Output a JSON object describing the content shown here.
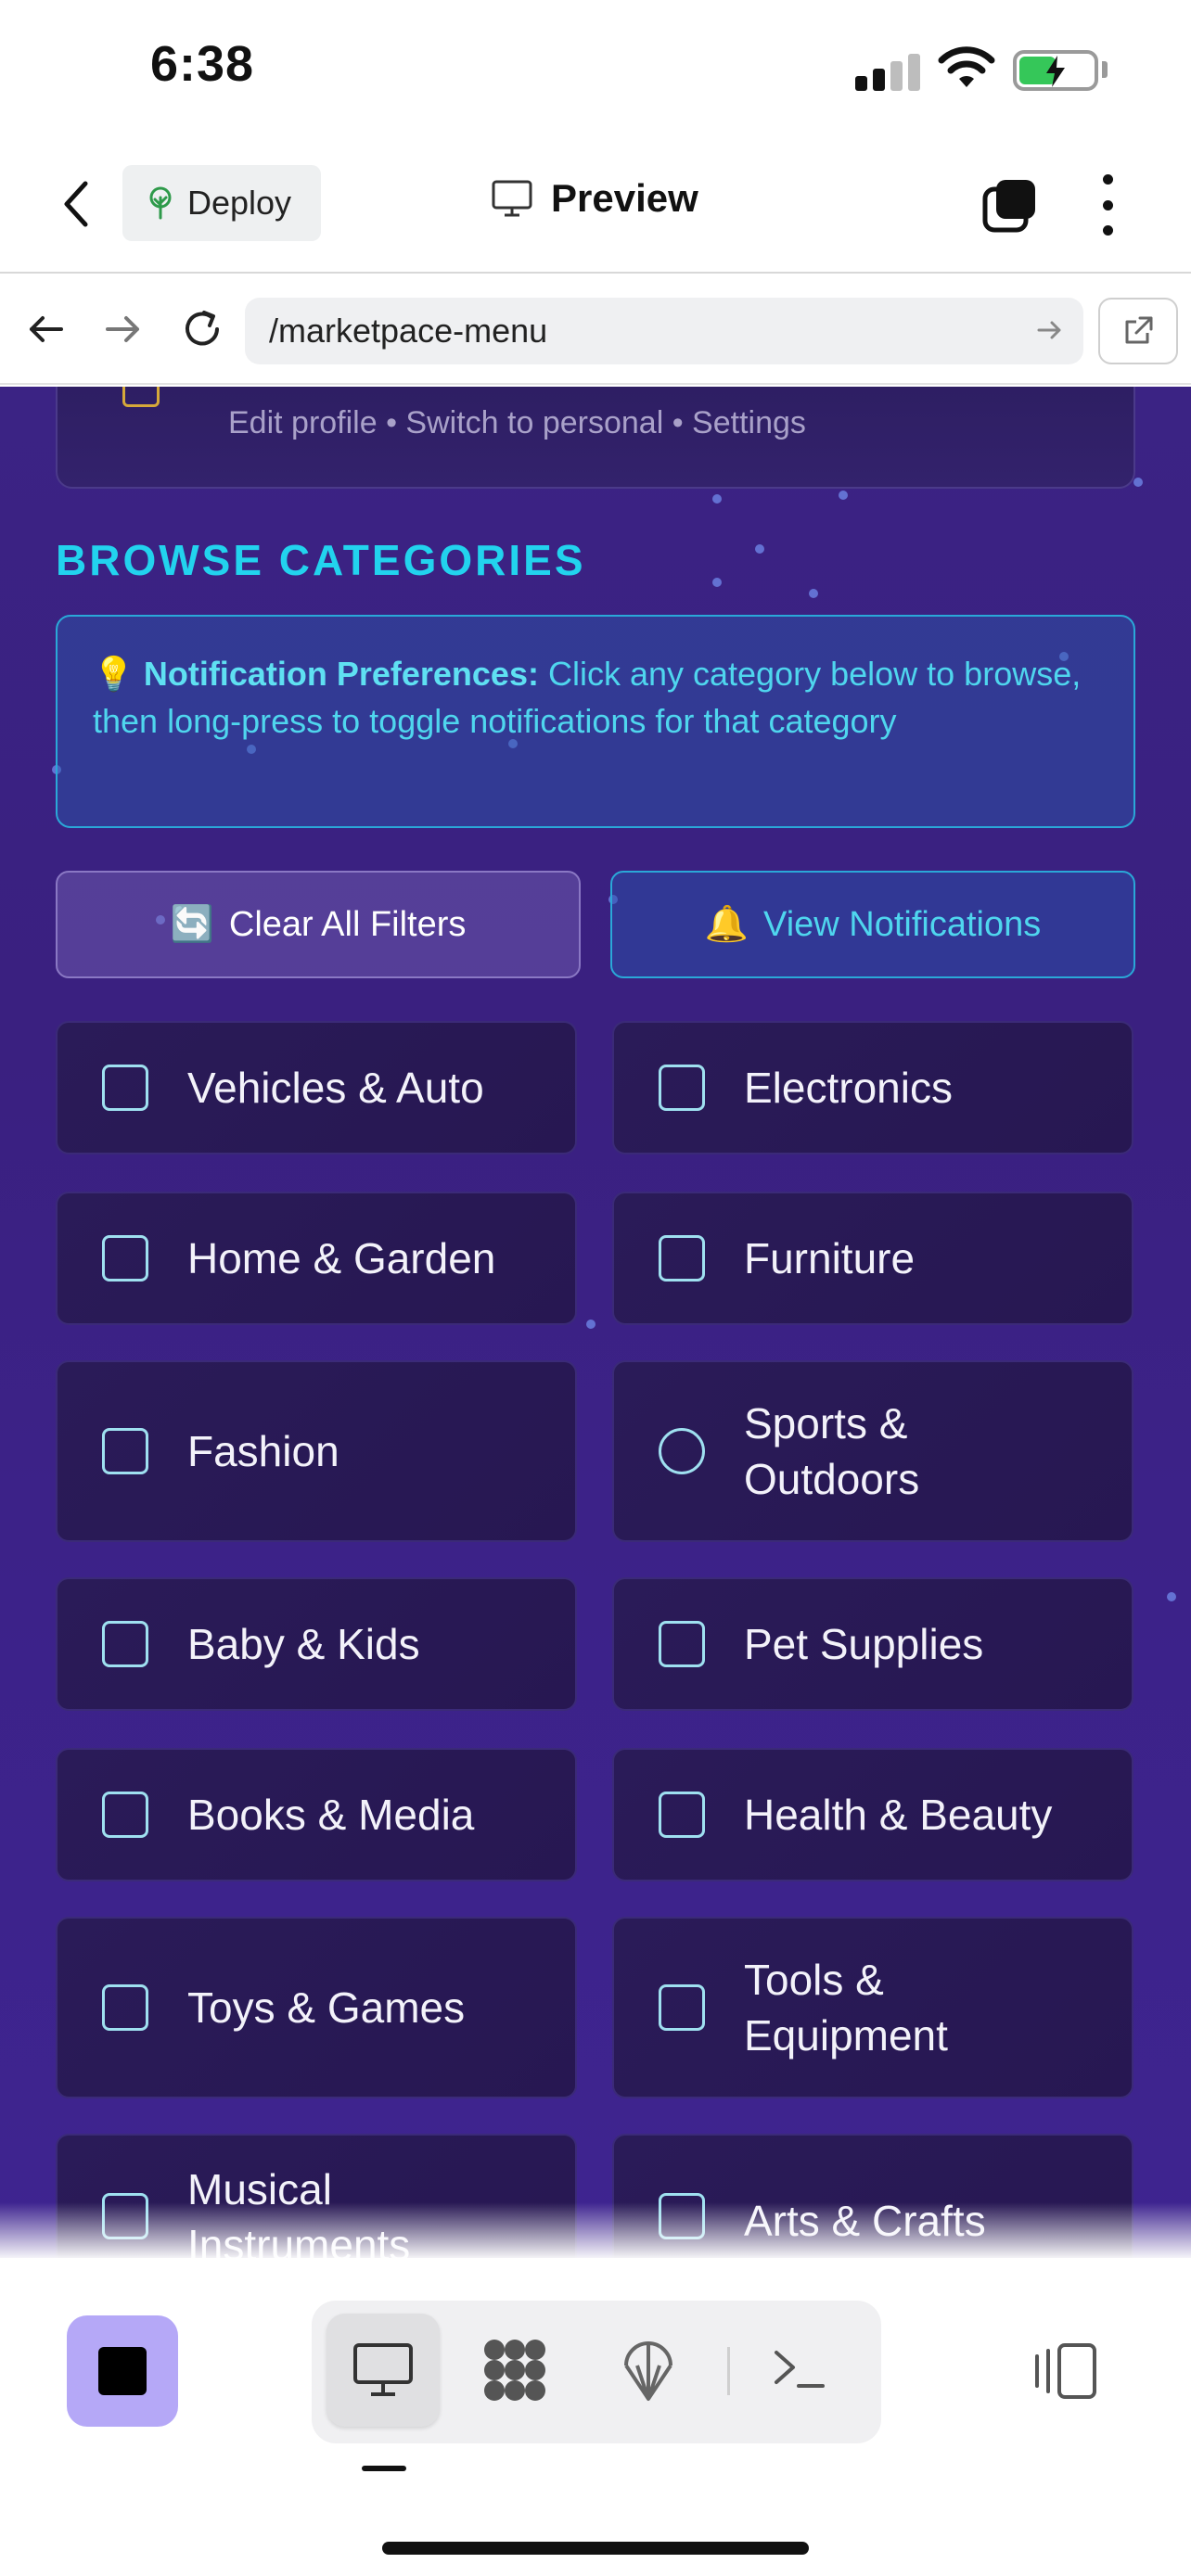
{
  "status_bar": {
    "time": "6:38"
  },
  "header": {
    "deploy_label": "Deploy",
    "title": "Preview"
  },
  "browser": {
    "url": "/marketpace-menu"
  },
  "profile": {
    "subtitle": "Edit profile • Switch to personal • Settings"
  },
  "section": {
    "title": "BROWSE CATEGORIES"
  },
  "info": {
    "icon": "💡",
    "bold": "Notification Preferences:",
    "text": " Click any category below to browse, then long-press to toggle notifications for that category"
  },
  "actions": {
    "clear_icon": "🔄",
    "clear_label": "Clear All Filters",
    "notif_icon": "🔔",
    "notif_label": "View Notifications"
  },
  "categories": [
    {
      "label": "Vehicles & Auto",
      "icon": "car-icon"
    },
    {
      "label": "Electronics",
      "icon": "monitor-icon"
    },
    {
      "label": "Home & Garden",
      "icon": "house-icon"
    },
    {
      "label": "Furniture",
      "icon": "cabinet-icon"
    },
    {
      "label": "Fashion",
      "icon": "shirt-icon"
    },
    {
      "label": "Sports & Outdoors",
      "icon": "ball-icon"
    },
    {
      "label": "Baby & Kids",
      "icon": "child-icon"
    },
    {
      "label": "Pet Supplies",
      "icon": "paw-icon"
    },
    {
      "label": "Books & Media",
      "icon": "book-icon"
    },
    {
      "label": "Health & Beauty",
      "icon": "health-icon"
    },
    {
      "label": "Toys & Games",
      "icon": "gamepad-icon"
    },
    {
      "label": "Tools & Equipment",
      "icon": "wrench-icon"
    },
    {
      "label": "Musical Instruments",
      "icon": "music-icon"
    },
    {
      "label": "Arts & Crafts",
      "icon": "star-icon"
    }
  ],
  "colors": {
    "accent": "#22d3ee",
    "background": "#3b2384",
    "card": "#2a1b58",
    "stop_button": "#b5a8f7"
  }
}
